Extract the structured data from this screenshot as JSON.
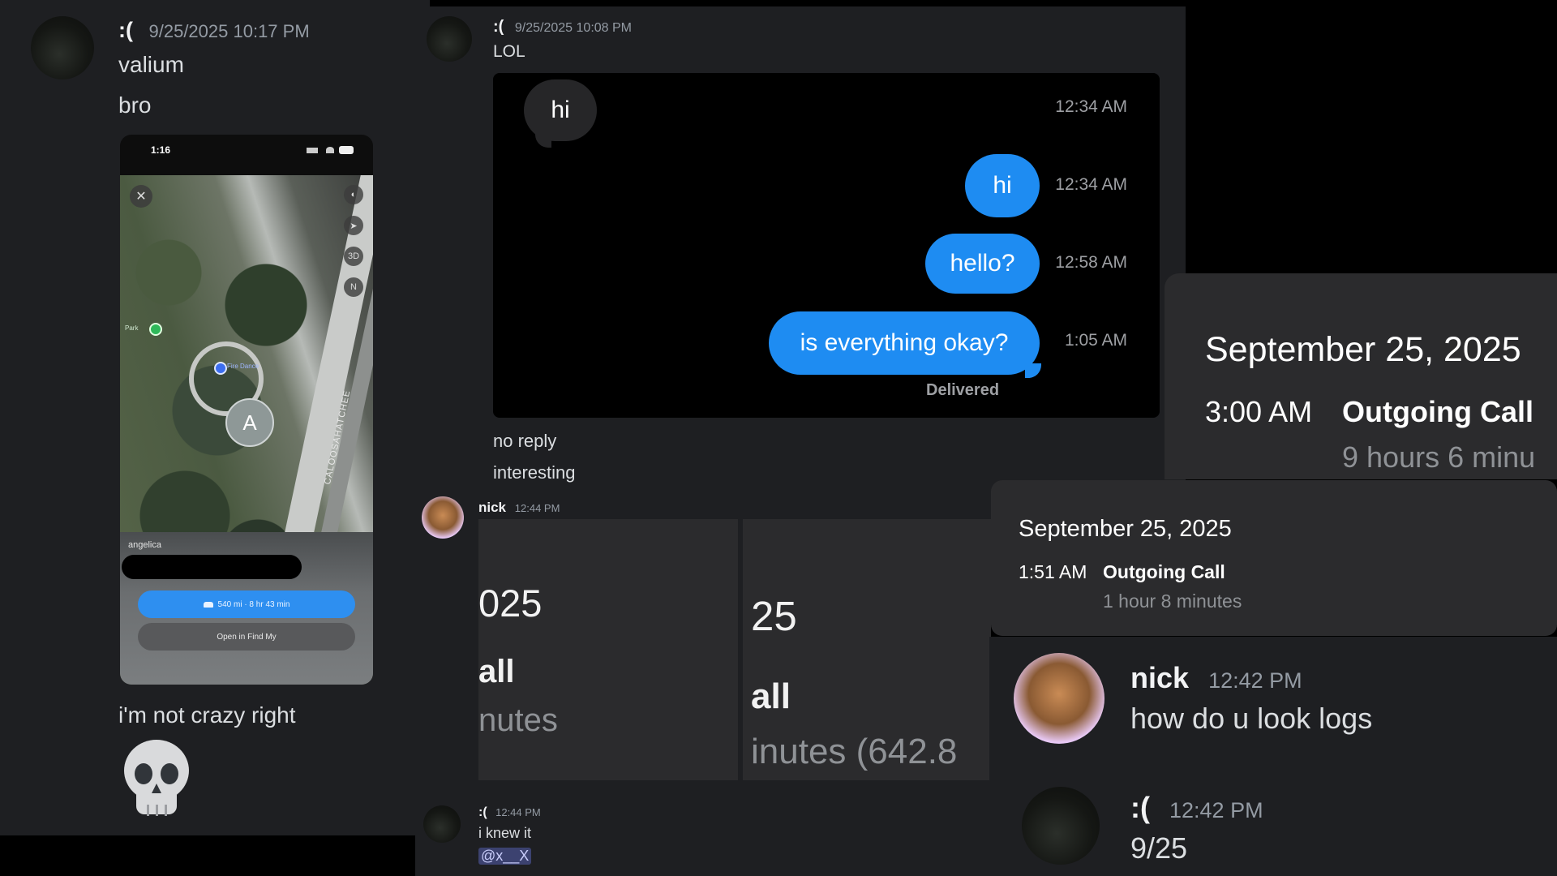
{
  "panel_a": {
    "user": ":(",
    "timestamp": "9/25/2025 10:17 PM",
    "messages": [
      "valium",
      "bro"
    ],
    "phone": {
      "status_time": "1:16",
      "map_controls": [
        "3D",
        "N"
      ],
      "pin_letter": "A",
      "person_label": "angelica",
      "directions": "540 mi · 8 hr 43 min",
      "open_button": "Open in Find My",
      "map_label_park": "Park",
      "map_label_place": "Fire Dance",
      "map_street": "CALOOSAHATCHEE"
    },
    "after_message": "i'm not crazy right",
    "emoji": "skull"
  },
  "panel_b": {
    "user": ":(",
    "timestamp": "9/25/2025 10:08 PM",
    "message": "LOL",
    "imessage": {
      "incoming": {
        "text": "hi",
        "time": "12:34 AM"
      },
      "outgoing": [
        {
          "text": "hi",
          "time": "12:34 AM"
        },
        {
          "text": "hello?",
          "time": "12:58 AM"
        },
        {
          "text": "is everything okay?",
          "time": "1:05 AM"
        }
      ],
      "status": "Delivered"
    },
    "after_messages": [
      "no reply",
      "interesting"
    ]
  },
  "panel_c": {
    "date": "September 25, 2025",
    "time": "3:00 AM",
    "type": "Outgoing Call",
    "duration": "9 hours 6 minu"
  },
  "panel_d": {
    "date": "September 25, 2025",
    "time": "1:51 AM",
    "type": "Outgoing Call",
    "duration": "1 hour 8 minutes"
  },
  "panel_e": {
    "user": "nick",
    "timestamp": "12:44 PM",
    "crop1": {
      "date": "025",
      "type": "all",
      "duration": "nutes"
    },
    "crop2": {
      "date": "25",
      "type": "all",
      "duration": "inutes (642.8"
    }
  },
  "panel_f": {
    "user": ":(",
    "timestamp": "12:44 PM",
    "message": "i knew it",
    "mention": "@x__X"
  },
  "panel_g": {
    "nick": {
      "user": "nick",
      "timestamp": "12:42 PM",
      "message": "how do u look logs"
    },
    "sad": {
      "user": ":(",
      "timestamp": "12:42 PM",
      "message": "9/25"
    }
  },
  "colors": {
    "discord_bg": "#1e1f22",
    "imessage_blue": "#1e8cf2",
    "imessage_gray": "#262628",
    "call_card_bg": "#2b2b2d",
    "mention_bg": "#3c4270",
    "mention_text": "#c9cdfb"
  }
}
